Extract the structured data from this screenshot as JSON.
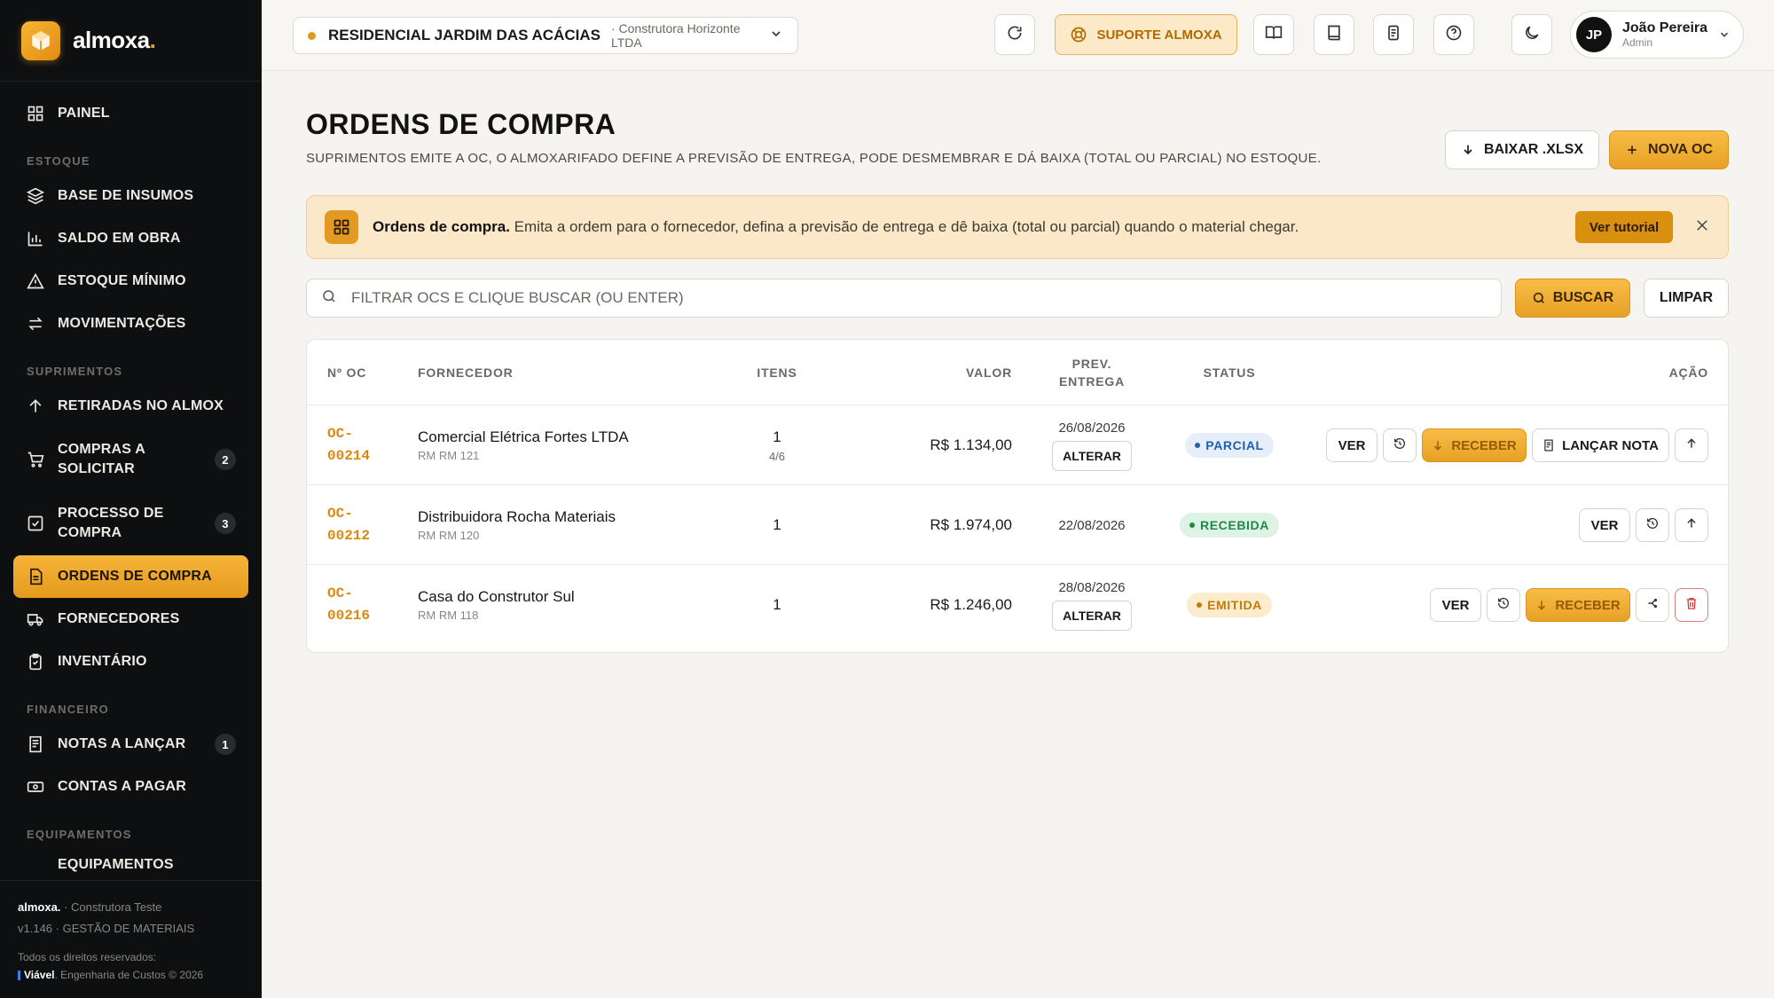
{
  "brand": {
    "name": "almoxa",
    "dot": "."
  },
  "sidebar": {
    "items": [
      {
        "label": "PAINEL",
        "icon": "grid-icon"
      },
      {
        "section": "ESTOQUE"
      },
      {
        "label": "BASE DE INSUMOS",
        "icon": "layers-icon"
      },
      {
        "label": "SALDO EM OBRA",
        "icon": "bar-chart-icon"
      },
      {
        "label": "ESTOQUE MÍNIMO",
        "icon": "warning-icon"
      },
      {
        "label": "MOVIMENTAÇÕES",
        "icon": "transfer-icon"
      },
      {
        "section": "SUPRIMENTOS"
      },
      {
        "label": "RETIRADAS NO ALMOX",
        "icon": "arrow-up-icon"
      },
      {
        "label": "COMPRAS A SOLICITAR",
        "icon": "cart-icon",
        "count": "2"
      },
      {
        "label": "PROCESSO DE COMPRA",
        "icon": "checkbox-icon",
        "count": "3"
      },
      {
        "label": "ORDENS DE COMPRA",
        "icon": "document-icon",
        "active": true
      },
      {
        "label": "FORNECEDORES",
        "icon": "truck-icon"
      },
      {
        "label": "INVENTÁRIO",
        "icon": "clipboard-icon"
      },
      {
        "section": "FINANCEIRO"
      },
      {
        "label": "NOTAS A LANÇAR",
        "icon": "receipt-icon",
        "count": "1"
      },
      {
        "label": "CONTAS A PAGAR",
        "icon": "cash-icon"
      },
      {
        "section": "EQUIPAMENTOS"
      },
      {
        "label": "EQUIPAMENTOS",
        "icon": "tool-icon"
      }
    ],
    "footer": {
      "brand": "almoxa.",
      "company": "· Construtora Teste",
      "version": "v1.146 · GESTÃO DE MATERIAIS",
      "rights": "Todos os direitos reservados:",
      "vendor": "Viável",
      "vendor_rest": ". Engenharia de Custos © 2026"
    }
  },
  "topbar": {
    "project_name": "RESIDENCIAL JARDIM DAS ACÁCIAS",
    "project_company": "· Construtora Horizonte LTDA",
    "support_label": "SUPORTE ALMOXA",
    "user_initials": "JP",
    "user_name": "João Pereira",
    "user_role": "Admin"
  },
  "page": {
    "title": "ORDENS DE COMPRA",
    "subtitle": "SUPRIMENTOS EMITE A OC, O ALMOXARIFADO DEFINE A PREVISÃO DE ENTREGA, PODE DESMEMBRAR E DÁ BAIXA (TOTAL OU PARCIAL) NO ESTOQUE.",
    "download_label": "BAIXAR .XLSX",
    "new_label": "NOVA OC"
  },
  "banner": {
    "title": "Ordens de compra.",
    "text": " Emita a ordem para o fornecedor, defina a previsão de entrega e dê baixa (total ou parcial) quando o material chegar.",
    "button": "Ver tutorial"
  },
  "search": {
    "placeholder": "FILTRAR OCS E CLIQUE BUSCAR (OU ENTER)",
    "value": "",
    "search_label": "BUSCAR",
    "clear_label": "LIMPAR"
  },
  "table": {
    "headers": {
      "oc": "Nº OC",
      "supplier": "FORNECEDOR",
      "items": "ITENS",
      "value": "VALOR",
      "pdate_1": "PREV.",
      "pdate_2": "ENTREGA",
      "status": "STATUS",
      "action": "AÇÃO"
    },
    "rows": [
      {
        "oc_1": "OC-",
        "oc_2": "00214",
        "supplier": "Comercial Elétrica Fortes LTDA",
        "ref": "RM RM 121",
        "items": "1",
        "items_sub": "4/6",
        "value": "R$ 1.134,00",
        "pdate": "26/08/2026",
        "alter": "ALTERAR",
        "status": "PARCIAL",
        "ver": "VER",
        "receber": "RECEBER",
        "lancar": "LANÇAR NOTA"
      },
      {
        "oc_1": "OC-",
        "oc_2": "00212",
        "supplier": "Distribuidora Rocha Materiais",
        "ref": "RM RM 120",
        "items": "1",
        "value": "R$ 1.974,00",
        "pdate": "22/08/2026",
        "status": "RECEBIDA",
        "ver": "VER"
      },
      {
        "oc_1": "OC-",
        "oc_2": "00216",
        "supplier": "Casa do Construtor Sul",
        "ref": "RM RM 118",
        "items": "1",
        "value": "R$ 1.246,00",
        "pdate": "28/08/2026",
        "alter": "ALTERAR",
        "status": "EMITIDA",
        "ver": "VER",
        "receber": "RECEBER"
      }
    ]
  },
  "colors": {
    "accent": "#e8a025",
    "sidebar_bg": "#0e0f10",
    "status_parcial": "#1f5fae",
    "status_recebida": "#1e8a46",
    "status_emitida": "#c27c09",
    "danger": "#d93c3c"
  }
}
